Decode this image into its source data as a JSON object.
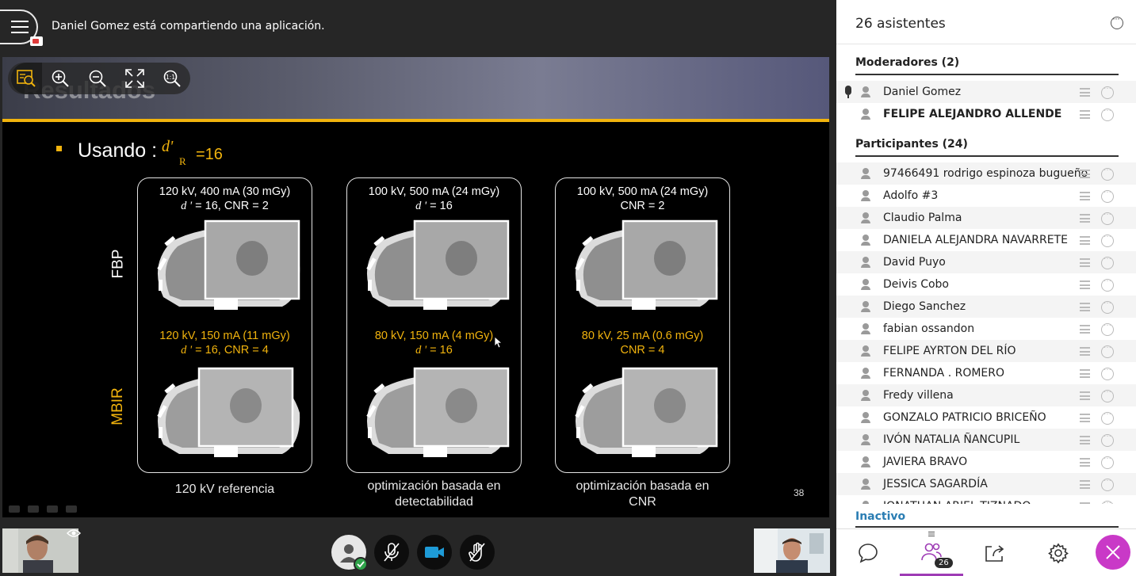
{
  "header": {
    "share_message": "Daniel Gomez está compartiendo una aplicación."
  },
  "slide": {
    "title": "Resultados",
    "bullet_text": "Usando :",
    "d_symbol": "d'",
    "d_sub": "R",
    "d_value": "=16",
    "page_number": "38",
    "row_labels": {
      "fbp": "FBP",
      "mbir": "MBIR"
    },
    "panels": [
      {
        "top1": "120 kV, 400 mA (30 mGy)",
        "top2_it": "d '",
        "top2": " = 16, CNR = 2",
        "mid1": "120 kV, 150 mA (11 mGy)",
        "mid2_it": "d '",
        "mid2": " = 16, CNR = 4",
        "caption1": "120 kV referencia",
        "caption2": ""
      },
      {
        "top1": "100 kV, 500 mA (24 mGy)",
        "top2_it": "d '",
        "top2": " = 16",
        "mid1": "80 kV, 150 mA (4 mGy)",
        "mid2_it": "d '",
        "mid2": " = 16",
        "caption1": "optimización basada en",
        "caption2": "detectabilidad"
      },
      {
        "top1": "100 kV, 500 mA (24 mGy)",
        "top2_it": "",
        "top2": "CNR = 2",
        "mid1": "80 kV, 25 mA (0.6 mGy)",
        "mid2_it": "",
        "mid2": "CNR = 4",
        "caption1": "optimización basada en",
        "caption2": "CNR"
      }
    ]
  },
  "zoom_toolbar": [
    "zoom-area-icon",
    "zoom-in-icon",
    "zoom-out-icon",
    "fit-screen-icon",
    "actual-size-icon"
  ],
  "attendees": {
    "title": "26 asistentes",
    "moderators_title": "Moderadores (2)",
    "moderators": [
      "Daniel Gomez",
      "FELIPE ALEJANDRO ALLENDE"
    ],
    "participants_title": "Participantes (24)",
    "participants": [
      "97466491 rodrigo espinoza bugueño",
      "Adolfo #3",
      "Claudio Palma",
      "DANIELA ALEJANDRA NAVARRETE",
      "David Puyo",
      "Deivis Cobo",
      "Diego Sanchez",
      "fabian ossandon",
      "FELIPE AYRTON DEL RÍO",
      "FERNANDA . ROMERO",
      "Fredy villena",
      "GONZALO PATRICIO BRICEÑO",
      "IVÓN NATALIA ÑANCUPIL",
      "JAVIERA BRAVO",
      "JESSICA SAGARDÍA",
      "JONATHAN ARIEL TIZNADO"
    ],
    "inactive_label": "Inactivo",
    "badge_count": "26"
  },
  "colors": {
    "accent_yellow": "#f1b30d",
    "close_magenta": "#c939c7",
    "active_tab": "#9e3bb5",
    "inactive_link": "#2a7db3"
  }
}
